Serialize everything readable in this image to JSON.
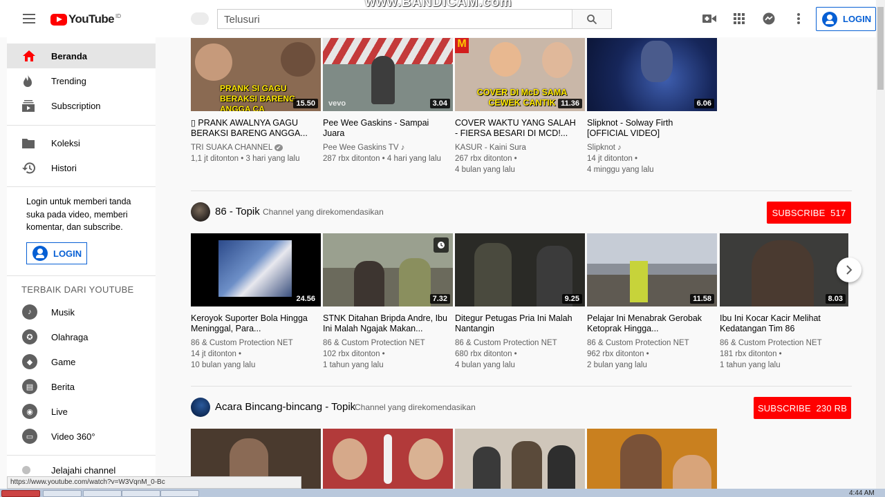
{
  "overlay": {
    "watermark": "www.BANDICAM.com",
    "status_url": "https://www.youtube.com/watch?v=W3VqnM_0-Bc",
    "clock": "4:44 AM"
  },
  "header": {
    "logo_text": "YouTube",
    "region": "ID",
    "search_placeholder": "Telusuri",
    "login_label": "LOGIN"
  },
  "sidebar": {
    "main": [
      {
        "label": "Beranda",
        "icon": "home-icon",
        "active": true
      },
      {
        "label": "Trending",
        "icon": "flame-icon"
      },
      {
        "label": "Subscription",
        "icon": "subscriptions-icon"
      }
    ],
    "library": [
      {
        "label": "Koleksi",
        "icon": "folder-icon"
      },
      {
        "label": "Histori",
        "icon": "history-icon"
      }
    ],
    "login_prompt": "Login untuk memberi tanda suka pada video, memberi komentar, dan subscribe.",
    "login_label": "LOGIN",
    "best_heading": "TERBAIK DARI YOUTUBE",
    "best": [
      {
        "label": "Musik",
        "icon": "music-icon"
      },
      {
        "label": "Olahraga",
        "icon": "sports-icon"
      },
      {
        "label": "Game",
        "icon": "gaming-icon"
      },
      {
        "label": "Berita",
        "icon": "news-icon"
      },
      {
        "label": "Live",
        "icon": "live-icon"
      },
      {
        "label": "Video 360°",
        "icon": "vr-icon"
      }
    ],
    "explore": {
      "label": "Jelajahi channel",
      "icon": "plus-icon"
    }
  },
  "sections": [
    {
      "videos": [
        {
          "title": "▯ PRANK AWALNYA GAGU BERAKSI BARENG ANGGA...",
          "channel": "TRI SUAKA CHANNEL",
          "badge": "✔",
          "views": "1,1 jt ditonton",
          "age": "3 hari yang lalu",
          "duration": "15.50",
          "thumb_text": "PRANK SI GAGU BERAKSI BARENG ANGGA CA",
          "thumb_color": "#8a6a52"
        },
        {
          "title": "Pee Wee Gaskins - Sampai Juara",
          "channel": "Pee Wee Gaskins TV",
          "badge": "♪",
          "views": "287 rbx ditonton",
          "age": "4 hari yang lalu",
          "duration": "3.04",
          "thumb_text": "vevo",
          "thumb_color": "#7f8b86"
        },
        {
          "title": "COVER WAKTU YANG SALAH - FIERSA BESARI DI MCD!...",
          "channel": "KASUR - Kaini Sura",
          "badge": "",
          "views": "267 rbx ditonton",
          "age": "4 bulan yang lalu",
          "duration": "11.36",
          "thumb_text": "COVER DI McD SAMA CEWEK CANTIK",
          "thumb_color": "#c9b7a8"
        },
        {
          "title": "Slipknot - Solway Firth [OFFICIAL VIDEO]",
          "channel": "Slipknot",
          "badge": "♪",
          "views": "14 jt ditonton",
          "age": "4 minggu yang lalu",
          "duration": "6.06",
          "thumb_text": "",
          "thumb_color": "#1c2f6e"
        }
      ]
    },
    {
      "title": "86 - Topik",
      "subtitle": "Channel yang direkomendasikan",
      "subscribe": "SUBSCRIBE",
      "sub_count": "517",
      "videos": [
        {
          "title": "Keroyok Suporter Bola Hingga Meninggal, Para...",
          "channel": "86 & Custom Protection NET",
          "views": "14 jt ditonton",
          "age": "10 bulan yang lalu",
          "duration": "24.56",
          "thumb_color": "#3b4d7a"
        },
        {
          "title": "STNK Ditahan Bripda Andre, Ibu Ini Malah Ngajak Makan...",
          "channel": "86 & Custom Protection NET",
          "views": "102 rbx ditonton",
          "age": "1 tahun yang lalu",
          "duration": "7.32",
          "thumb_color": "#6b6a5c"
        },
        {
          "title": "Ditegur Petugas Pria Ini Malah Nantangin",
          "channel": "86 & Custom Protection NET",
          "views": "680 rbx ditonton",
          "age": "4 bulan yang lalu",
          "duration": "9.25",
          "thumb_color": "#2a2a26"
        },
        {
          "title": "Pelajar Ini Menabrak Gerobak Ketoprak Hingga...",
          "channel": "86 & Custom Protection NET",
          "views": "962 rbx ditonton",
          "age": "2 bulan yang lalu",
          "duration": "11.58",
          "thumb_color": "#8a8f98"
        },
        {
          "title": "Ibu Ini Kocar Kacir Melihat Kedatangan Tim 86",
          "channel": "86 & Custom Protection NET",
          "views": "181 rbx ditonton",
          "age": "1 tahun yang lalu",
          "duration": "8.03",
          "thumb_color": "#3c3c3a"
        }
      ]
    },
    {
      "title": "Acara Bincang-bincang - Topik",
      "subtitle": "Channel yang direkomendasikan",
      "subscribe": "SUBSCRIBE",
      "sub_count": "230 RB",
      "videos": [
        {
          "thumb_color": "#4a3a2e"
        },
        {
          "thumb_color": "#b23a3a"
        },
        {
          "thumb_color": "#cfc6ba"
        },
        {
          "thumb_color": "#c9801f"
        }
      ]
    }
  ]
}
